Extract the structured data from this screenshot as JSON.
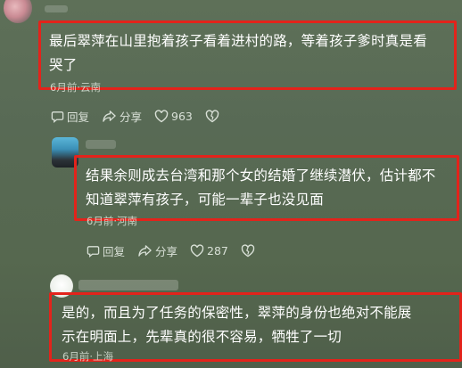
{
  "comments": [
    {
      "text_line1": "最后翠萍在山里抱着孩子看着进村的路，等着孩子爹时真是看",
      "text_line2": "哭了",
      "meta": "6月前·云南",
      "actions": {
        "reply": "回复",
        "share": "分享",
        "likes": "963"
      }
    },
    {
      "text_line1": "结果余则成去台湾和那个女的结婚了继续潜伏，估计都不",
      "text_line2": "知道翠萍有孩子，可能一辈子也没见面",
      "meta": "6月前·河南",
      "actions": {
        "reply": "回复",
        "share": "分享",
        "likes": "287"
      }
    },
    {
      "text_line1": "是的，而且为了任务的保密性，翠萍的身份也绝对不能展",
      "text_line2": "示在明面上，先辈真的很不容易，牺牲了一切",
      "meta": "6月前·上海"
    }
  ],
  "highlight_color": "#e3231b"
}
